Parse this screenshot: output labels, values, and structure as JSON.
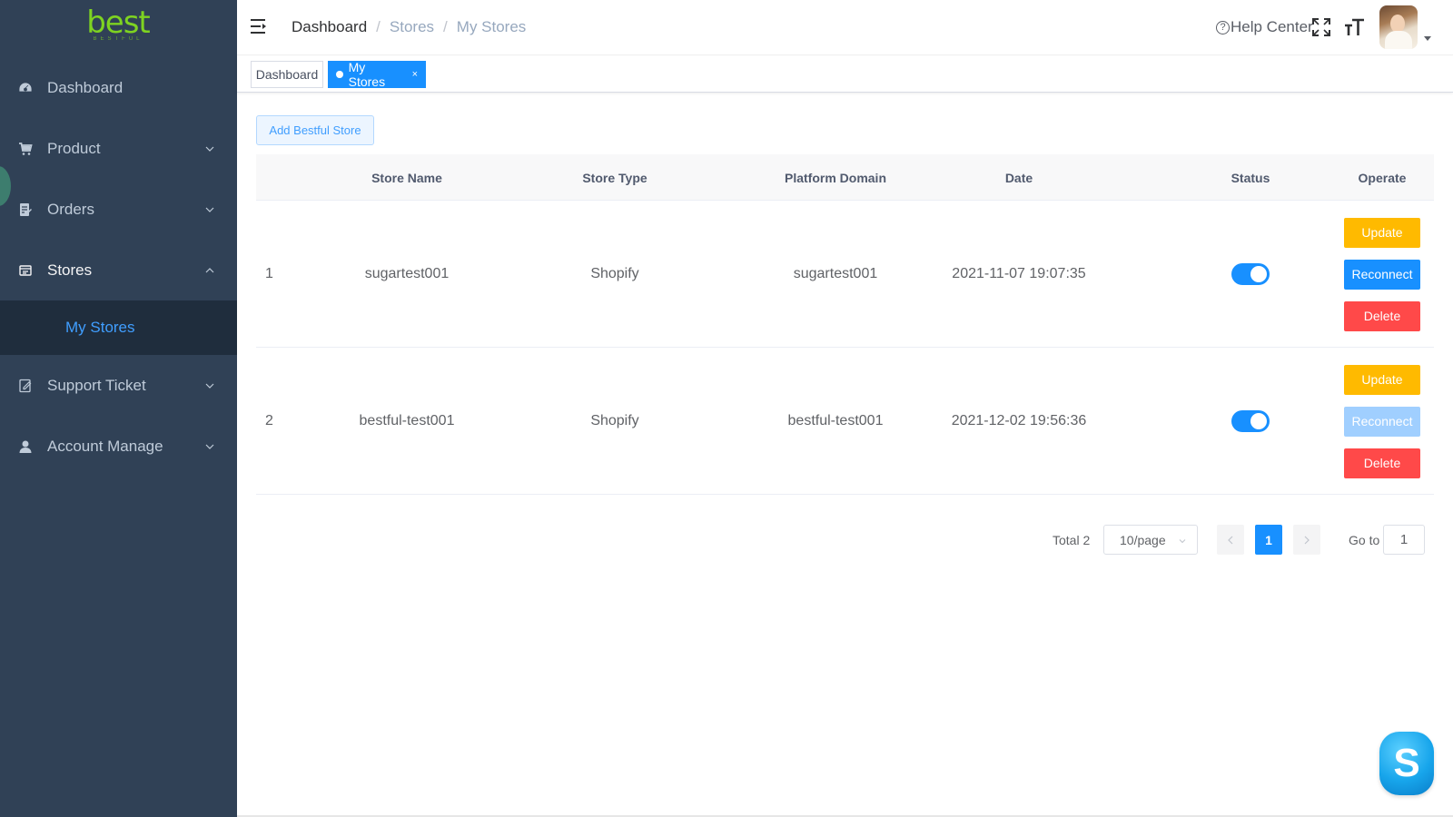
{
  "brand": {
    "logo_text": "best",
    "logo_subtext": "BESTFUL"
  },
  "sidebar": {
    "items": [
      {
        "label": "Dashboard",
        "icon": "dashboard-icon"
      },
      {
        "label": "Product",
        "icon": "cart-icon"
      },
      {
        "label": "Orders",
        "icon": "orders-icon"
      },
      {
        "label": "Stores",
        "icon": "stores-icon"
      },
      {
        "label": "Support Ticket",
        "icon": "ticket-icon"
      },
      {
        "label": "Account Manage",
        "icon": "user-icon"
      }
    ],
    "submenu": {
      "label": "My Stores"
    }
  },
  "header": {
    "breadcrumb": [
      "Dashboard",
      "Stores",
      "My Stores"
    ],
    "help_label": "Help Center"
  },
  "tags": {
    "dashboard": "Dashboard",
    "active": "My Stores",
    "close": "×"
  },
  "content": {
    "add_button": "Add Bestful Store",
    "columns": [
      "Store Name",
      "Store Type",
      "Platform Domain",
      "Date",
      "Status",
      "Operate"
    ],
    "rows": [
      {
        "index": "1",
        "name": "sugartest001",
        "type": "Shopify",
        "domain": "sugartest001",
        "date": "2021-11-07 19:07:35",
        "status_on": true,
        "reconnect_enabled": true
      },
      {
        "index": "2",
        "name": "bestful-test001",
        "type": "Shopify",
        "domain": "bestful-test001",
        "date": "2021-12-02 19:56:36",
        "status_on": true,
        "reconnect_enabled": false
      }
    ],
    "actions": {
      "update": "Update",
      "reconnect": "Reconnect",
      "delete": "Delete"
    }
  },
  "pagination": {
    "total": "Total 2",
    "page_size": "10/page",
    "current_page": "1",
    "goto_label": "Go to",
    "goto_value": "1"
  },
  "colors": {
    "sidebar_bg": "#304156",
    "primary": "#1890ff",
    "warning": "#ffba00",
    "danger": "#ff4949",
    "logo_green": "#7ed321"
  },
  "skype": {
    "letter": "S"
  }
}
